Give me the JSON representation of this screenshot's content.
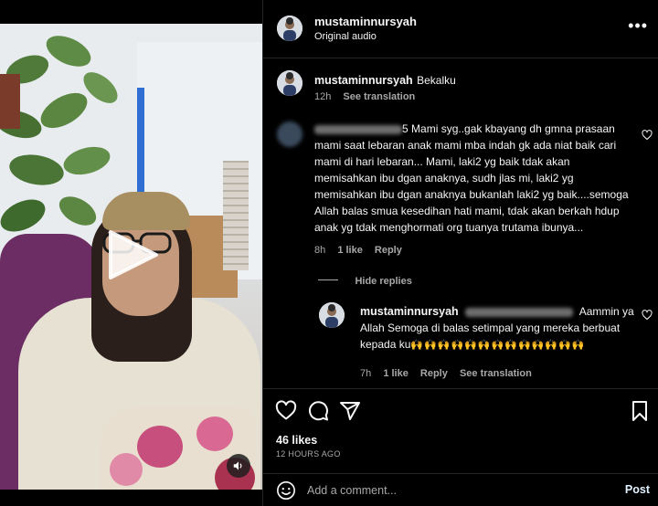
{
  "header": {
    "username": "mustaminnursyah",
    "subtitle": "Original audio",
    "more_icon": "more-horizontal-icon"
  },
  "caption": {
    "username": "mustaminnursyah",
    "text": "Bekalku",
    "time": "12h",
    "translation": "See translation"
  },
  "comments": [
    {
      "username_visible_suffix": "5",
      "text": "Mami syg..gak kbayang dh gmna prasaan mami saat lebaran anak mami mba indah gk ada niat baik cari mami di hari lebaran... Mami, laki2 yg baik tdak akan memisahkan ibu dgan anaknya, sudh jlas mi, laki2 yg memisahkan ibu dgan anaknya bukanlah laki2 yg baik....semoga Allah balas smua kesedihan hati mami, tdak akan berkah hdup anak yg tdak menghormati org tuanya trutama ibunya...",
      "time": "8h",
      "likes": "1 like",
      "reply": "Reply",
      "hide_replies": "Hide replies",
      "replies": [
        {
          "username": "mustaminnursyah",
          "text": "Aammin ya Allah Semoga di balas setimpal yang mereka berbuat kepada ku",
          "emoji": "🙌🙌🙌🙌🙌🙌🙌🙌🙌🙌🙌🙌🙌",
          "time": "7h",
          "likes": "1 like",
          "reply": "Reply",
          "translation": "See translation"
        }
      ]
    }
  ],
  "actions": {
    "like_icon": "heart-icon",
    "comment_icon": "comment-icon",
    "share_icon": "share-icon",
    "save_icon": "bookmark-icon",
    "likes": "46 likes",
    "timeago": "12 HOURS AGO"
  },
  "add_comment": {
    "placeholder": "Add a comment...",
    "post_label": "Post",
    "emoji_icon": "smiley-icon"
  },
  "video": {
    "play_icon": "play-icon",
    "sound_icon": "sound-icon"
  },
  "colors": {
    "background": "#000000",
    "text": "#f5f5f5",
    "muted": "#a8a8a8",
    "divider": "#262626"
  }
}
